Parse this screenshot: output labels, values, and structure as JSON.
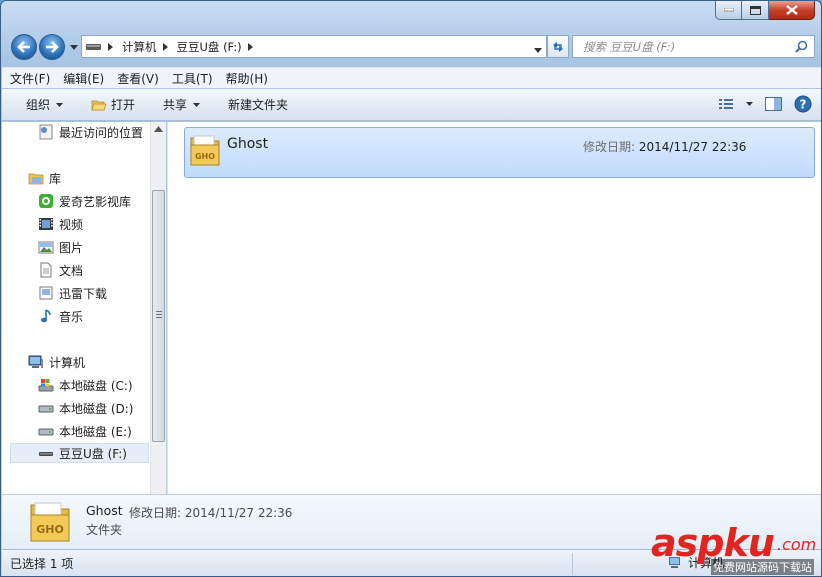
{
  "window": {
    "caption": {
      "minimize": "minimize",
      "maximize": "maximize",
      "close": "close"
    }
  },
  "address": {
    "crumbs": [
      "计算机",
      "豆豆U盘 (F:)"
    ],
    "search_placeholder": "搜索 豆豆U盘 (F:)"
  },
  "menu": [
    "文件(F)",
    "编辑(E)",
    "查看(V)",
    "工具(T)",
    "帮助(H)"
  ],
  "commands": {
    "organize": "组织",
    "open": "打开",
    "share": "共享",
    "new_folder": "新建文件夹"
  },
  "nav": {
    "recent": "最近访问的位置",
    "library": "库",
    "library_items": [
      "爱奇艺影视库",
      "视频",
      "图片",
      "文档",
      "迅雷下载",
      "音乐"
    ],
    "computer": "计算机",
    "drives": [
      "本地磁盘 (C:)",
      "本地磁盘 (D:)",
      "本地磁盘 (E:)",
      "豆豆U盘 (F:)"
    ]
  },
  "file": {
    "name": "Ghost",
    "date_label": "修改日期:",
    "date_value": "2014/11/27 22:36",
    "icon_text": "GHO"
  },
  "details": {
    "name": "Ghost",
    "date_label": "修改日期:",
    "date_value": "2014/11/27 22:36",
    "type": "文件夹",
    "icon_text": "GHO"
  },
  "status": {
    "selected": "已选择 1 项",
    "computer": "计算机"
  },
  "watermark": {
    "brand_a": "asp",
    "brand_b": "ku",
    "tld": ".com",
    "tagline": "免费网站源码下载站"
  },
  "colors": {
    "accent": "#2b6fb5",
    "selection": "#c1dbfc",
    "watermark": "#e2241f"
  }
}
